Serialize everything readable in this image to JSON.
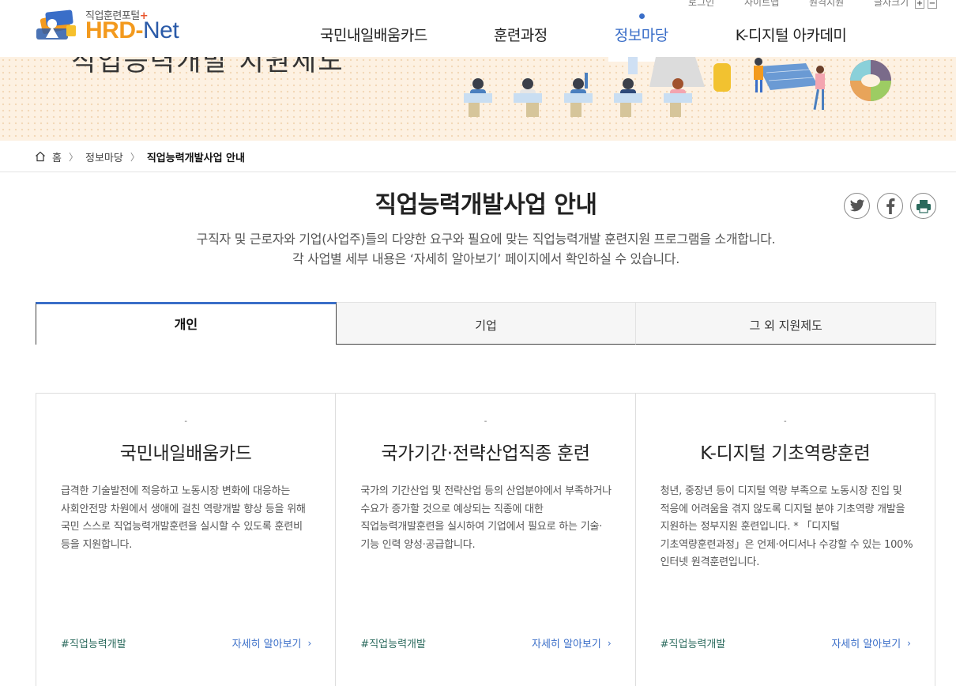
{
  "header": {
    "logo_sub": "직업훈련포털",
    "logo_plus": "+",
    "logo_hrd": "HRD",
    "logo_dash": "-",
    "logo_net": "Net",
    "util_links": [
      "로그인",
      "사이트맵",
      "원격지원",
      "글자크기"
    ],
    "zoom_in": "+",
    "zoom_out": "−",
    "nav": [
      {
        "label": "국민내일배움카드",
        "active": false
      },
      {
        "label": "훈련과정",
        "active": false
      },
      {
        "label": "정보마당",
        "active": true
      },
      {
        "label": "K-디지털 아카데미",
        "active": false
      }
    ]
  },
  "banner": {
    "title": "직업능력개발 지원제도"
  },
  "breadcrumb": {
    "home": "홈",
    "level1": "정보마당",
    "current": "직업능력개발사업 안내"
  },
  "page": {
    "title": "직업능력개발사업 안내",
    "desc_line1": "구직자 및 근로자와 기업(사업주)들의 다양한 요구와 필요에 맞는 직업능력개발 훈련지원 프로그램을 소개합니다.",
    "desc_line2": "각 사업별 세부 내용은 ‘자세히 알아보기’ 페이지에서 확인하실 수 있습니다."
  },
  "share": {
    "twitter_icon": "twitter-icon",
    "facebook_icon": "facebook-icon",
    "print_icon": "printer-icon"
  },
  "tabs": [
    {
      "label": "개인",
      "active": true
    },
    {
      "label": "기업",
      "active": false
    },
    {
      "label": "그 외 지원제도",
      "active": false
    }
  ],
  "cards": [
    {
      "dash": "-",
      "title": "국민내일배움카드",
      "text": "급격한 기술발전에 적응하고 노동시장 변화에 대응하는 사회안전망 차원에서 생애에 걸친 역량개발 향상 등을 위해 국민 스스로 직업능력개발훈련을 실시할 수 있도록 훈련비 등을 지원합니다.",
      "tag": "#직업능력개발",
      "more": "자세히 알아보기"
    },
    {
      "dash": "-",
      "title": "국가기간·전략산업직종 훈련",
      "text": "국가의 기간산업 및 전략산업 등의 산업분야에서 부족하거나 수요가 증가할 것으로 예상되는 직종에 대한 직업능력개발훈련을 실시하여 기업에서 필요로 하는 기술·기능 인력 양성·공급합니다.",
      "tag": "#직업능력개발",
      "more": "자세히 알아보기"
    },
    {
      "dash": "-",
      "title": "K-디지털 기초역량훈련",
      "text": "청년, 중장년 등이 디지털 역량 부족으로 노동시장 진입 및 적응에 어려움을 겪지 않도록 디지털 분야 기초역량 개발을 지원하는 정부지원 훈련입니다. * 「디지털 기초역량훈련과정」은 언제·어디서나 수강할 수 있는 100% 인터넷 원격훈련입니다.",
      "tag": "#직업능력개발",
      "more": "자세히 알아보기"
    }
  ],
  "colors": {
    "accent": "#3a6ec8",
    "logo_orange": "#f39a1e",
    "logo_blue": "#2a5aa8",
    "tag_green": "#2b6a5d",
    "banner_bg": "#fdf1e2"
  }
}
